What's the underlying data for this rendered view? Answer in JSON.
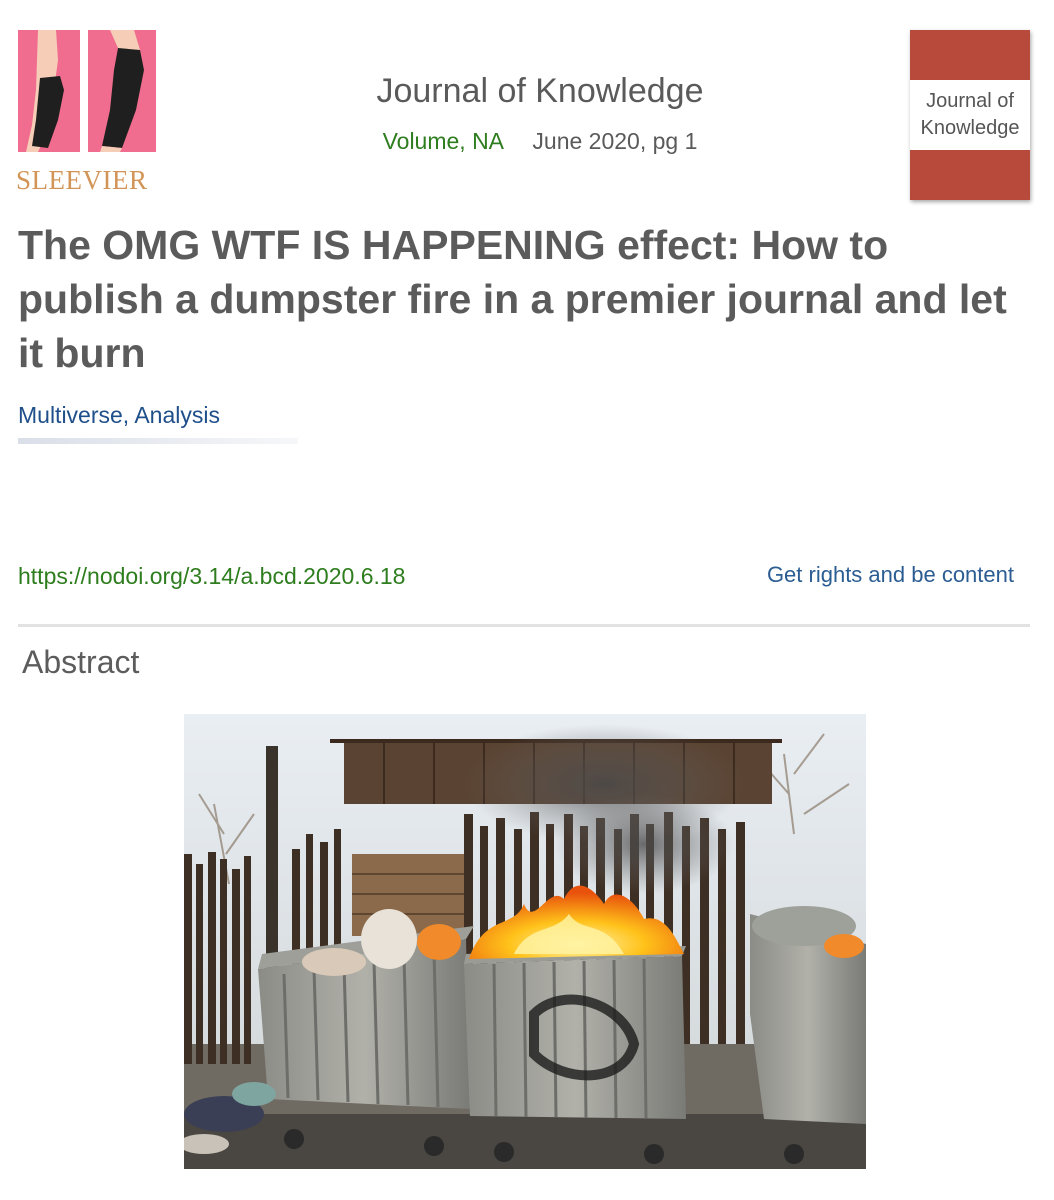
{
  "publisher": {
    "name": "SLEEVIER"
  },
  "journal": {
    "title": "Journal of Knowledge",
    "volume": "Volume, NA",
    "date_page": "June 2020, pg 1",
    "cover_title": "Journal of Knowledge"
  },
  "article": {
    "title": "The OMG WTF IS HAPPENING effect: How to publish a dumpster fire in a premier journal and let it burn",
    "authors": "Multiverse, Analysis",
    "doi": "https://nodoi.org/3.14/a.bcd.2020.6.18",
    "rights_link": "Get rights and be content",
    "abstract_heading": "Abstract"
  },
  "colors": {
    "cover_red": "#b74a3a",
    "volume_green": "#2e7d1e",
    "link_blue": "#2b5d93",
    "publisher_gold": "#d39557"
  }
}
